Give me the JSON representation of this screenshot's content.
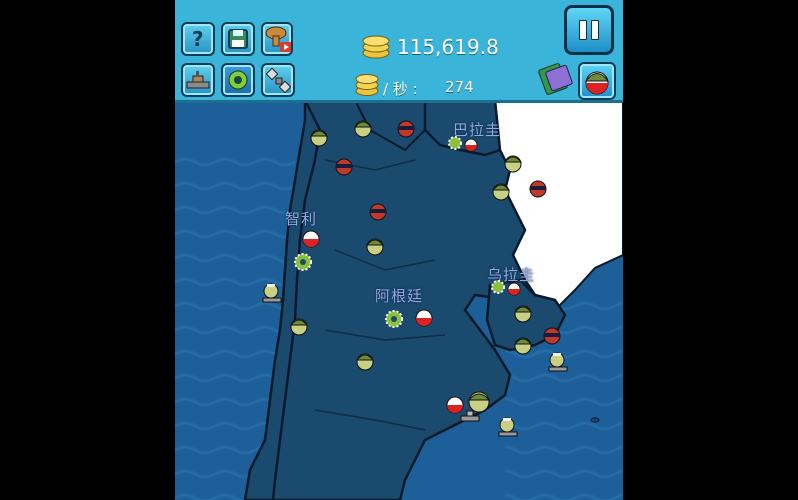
{
  "hud": {
    "money_total": "115,619.8",
    "income_label": "/ 秒 :",
    "income_value": "274",
    "buttons": [
      {
        "name": "help-button",
        "icon": "question-icon"
      },
      {
        "name": "save-button",
        "icon": "floppy-disk-icon"
      },
      {
        "name": "nuke-video-button",
        "icon": "nuclear-explosion-icon"
      },
      {
        "name": "navy-button",
        "icon": "battleship-icon"
      },
      {
        "name": "defense-button",
        "icon": "shield-emblem-icon"
      },
      {
        "name": "satellite-button",
        "icon": "satellite-icon"
      }
    ],
    "pause_icon": "pause-icon"
  },
  "map": {
    "regions": [
      {
        "name": "paraguay",
        "label": "巴拉圭"
      },
      {
        "name": "chile",
        "label": "智利"
      },
      {
        "name": "argentina",
        "label": "阿根廷"
      },
      {
        "name": "uruguay",
        "label": "乌拉圭"
      }
    ]
  },
  "colors": {
    "hud": "#3ab4d8",
    "ocean": "#1d5f99",
    "land_enemy": "#1a4a6e",
    "land_neutral": "#ffffff",
    "border": "#0a1a2a"
  }
}
